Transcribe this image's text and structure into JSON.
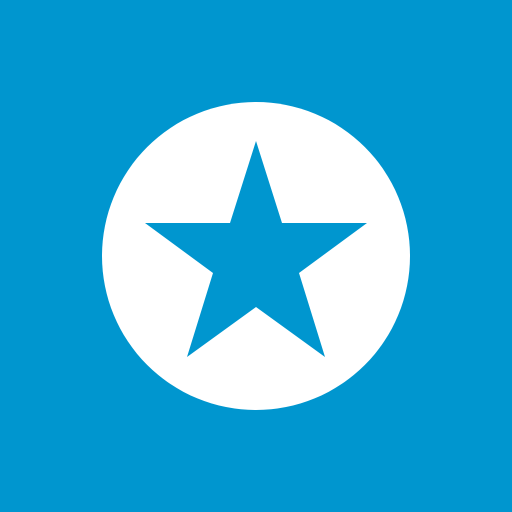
{
  "icon": {
    "name": "star-icon",
    "background_color": "#0096CF",
    "circle_color": "#FFFFFF",
    "star_color": "#0096CF"
  }
}
